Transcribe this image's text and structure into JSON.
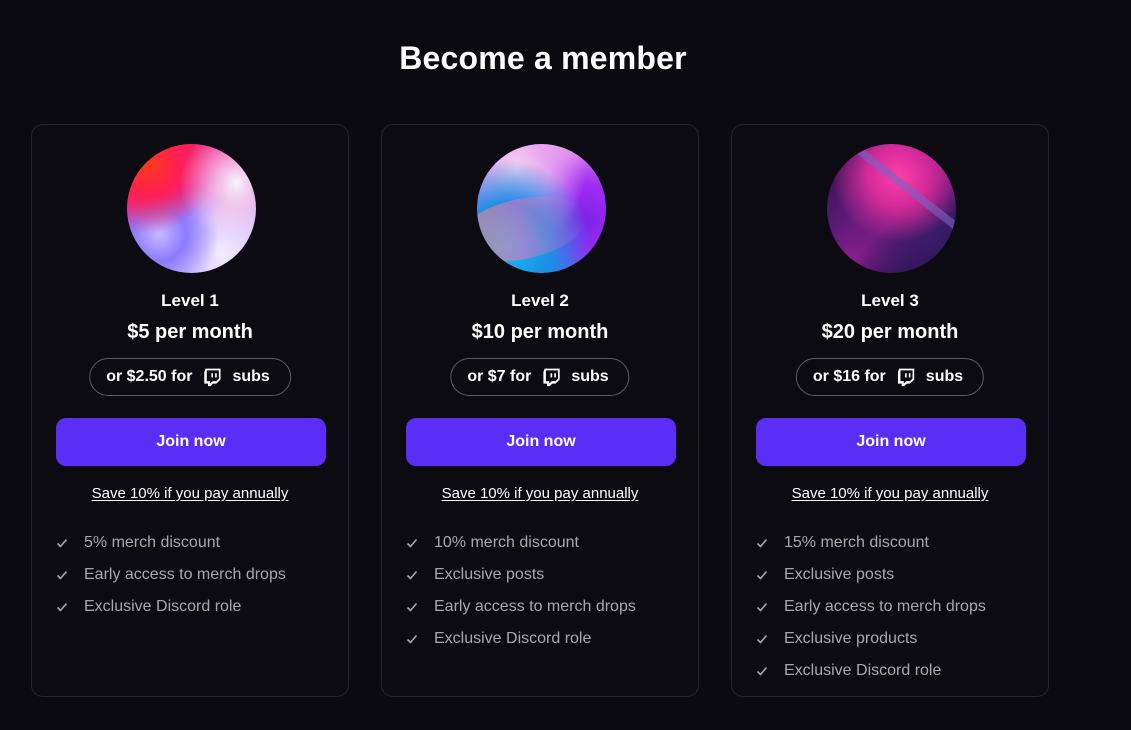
{
  "heading": "Become a member",
  "colors": {
    "background": "#0b0a11",
    "accent_button": "#5b2ef8",
    "card_border": "#26252d",
    "benefit_text": "#a8a7b1"
  },
  "icons": {
    "subs": "twitch-icon",
    "benefit": "check-icon"
  },
  "tiers": [
    {
      "level": "Level 1",
      "price": "$5 per month",
      "subs_prefix": "or $2.50 for",
      "subs_suffix": "subs",
      "join_label": "Join now",
      "annual_label": "Save 10% if you pay annually",
      "benefits": [
        "5% merch discount",
        "Early access to merch drops",
        "Exclusive Discord role"
      ]
    },
    {
      "level": "Level 2",
      "price": "$10 per month",
      "subs_prefix": "or $7 for",
      "subs_suffix": "subs",
      "join_label": "Join now",
      "annual_label": "Save 10% if you pay annually",
      "benefits": [
        "10% merch discount",
        "Exclusive posts",
        "Early access to merch drops",
        "Exclusive Discord role"
      ]
    },
    {
      "level": "Level 3",
      "price": "$20 per month",
      "subs_prefix": "or $16 for",
      "subs_suffix": "subs",
      "join_label": "Join now",
      "annual_label": "Save 10% if you pay annually",
      "benefits": [
        "15% merch discount",
        "Exclusive posts",
        "Early access to merch drops",
        "Exclusive products",
        "Exclusive Discord role"
      ]
    }
  ]
}
